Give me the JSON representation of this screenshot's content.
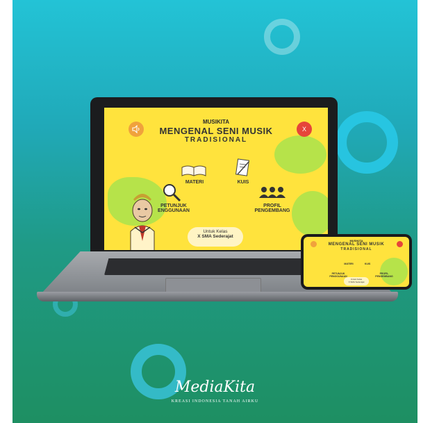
{
  "app": {
    "subtitle": "MUSIKITA",
    "title_line1": "MENGENAL SENI MUSIK",
    "title_line2": "TRADISIONAL",
    "close_label": "X",
    "menu": {
      "materi": "MATERI",
      "kuis": "KUIS",
      "petunjuk_line1": "PETUNJUK",
      "petunjuk_line2": "ENGGUNAAN",
      "profil_line1": "PROFIL",
      "profil_line2": "PENGEMBANG"
    },
    "class_badge_line1": "Untuk Kelas",
    "class_badge_line2": "X SMA Sederajat"
  },
  "phone_app": {
    "subtitle": "MUSIKITA",
    "title_line1": "MENGENAL SENI MUSIK",
    "title_line2": "TRADISIONAL",
    "materi": "MATERI",
    "kuis": "KUIS",
    "petunjuk_line1": "PETUNJUK",
    "petunjuk_line2": "PENGGUNAAN",
    "profil_line1": "PROFIL",
    "profil_line2": "PENGEMBANG",
    "badge_line1": "Untuk Kelas",
    "badge_line2": "X SMA Sederajat"
  },
  "branding": {
    "logo_text": "MediaKita",
    "tagline": "KREASI INDONESIA TANAH AIRKU"
  },
  "colors": {
    "screen_yellow": "#ffe33d",
    "blob_green": "#b6e34a",
    "sound_button": "#f0a23c",
    "close_button": "#e6453a"
  },
  "icons": [
    "speaker-icon",
    "close-icon",
    "book-icon",
    "quiz-paper-icon",
    "magnifier-icon",
    "people-icon"
  ]
}
